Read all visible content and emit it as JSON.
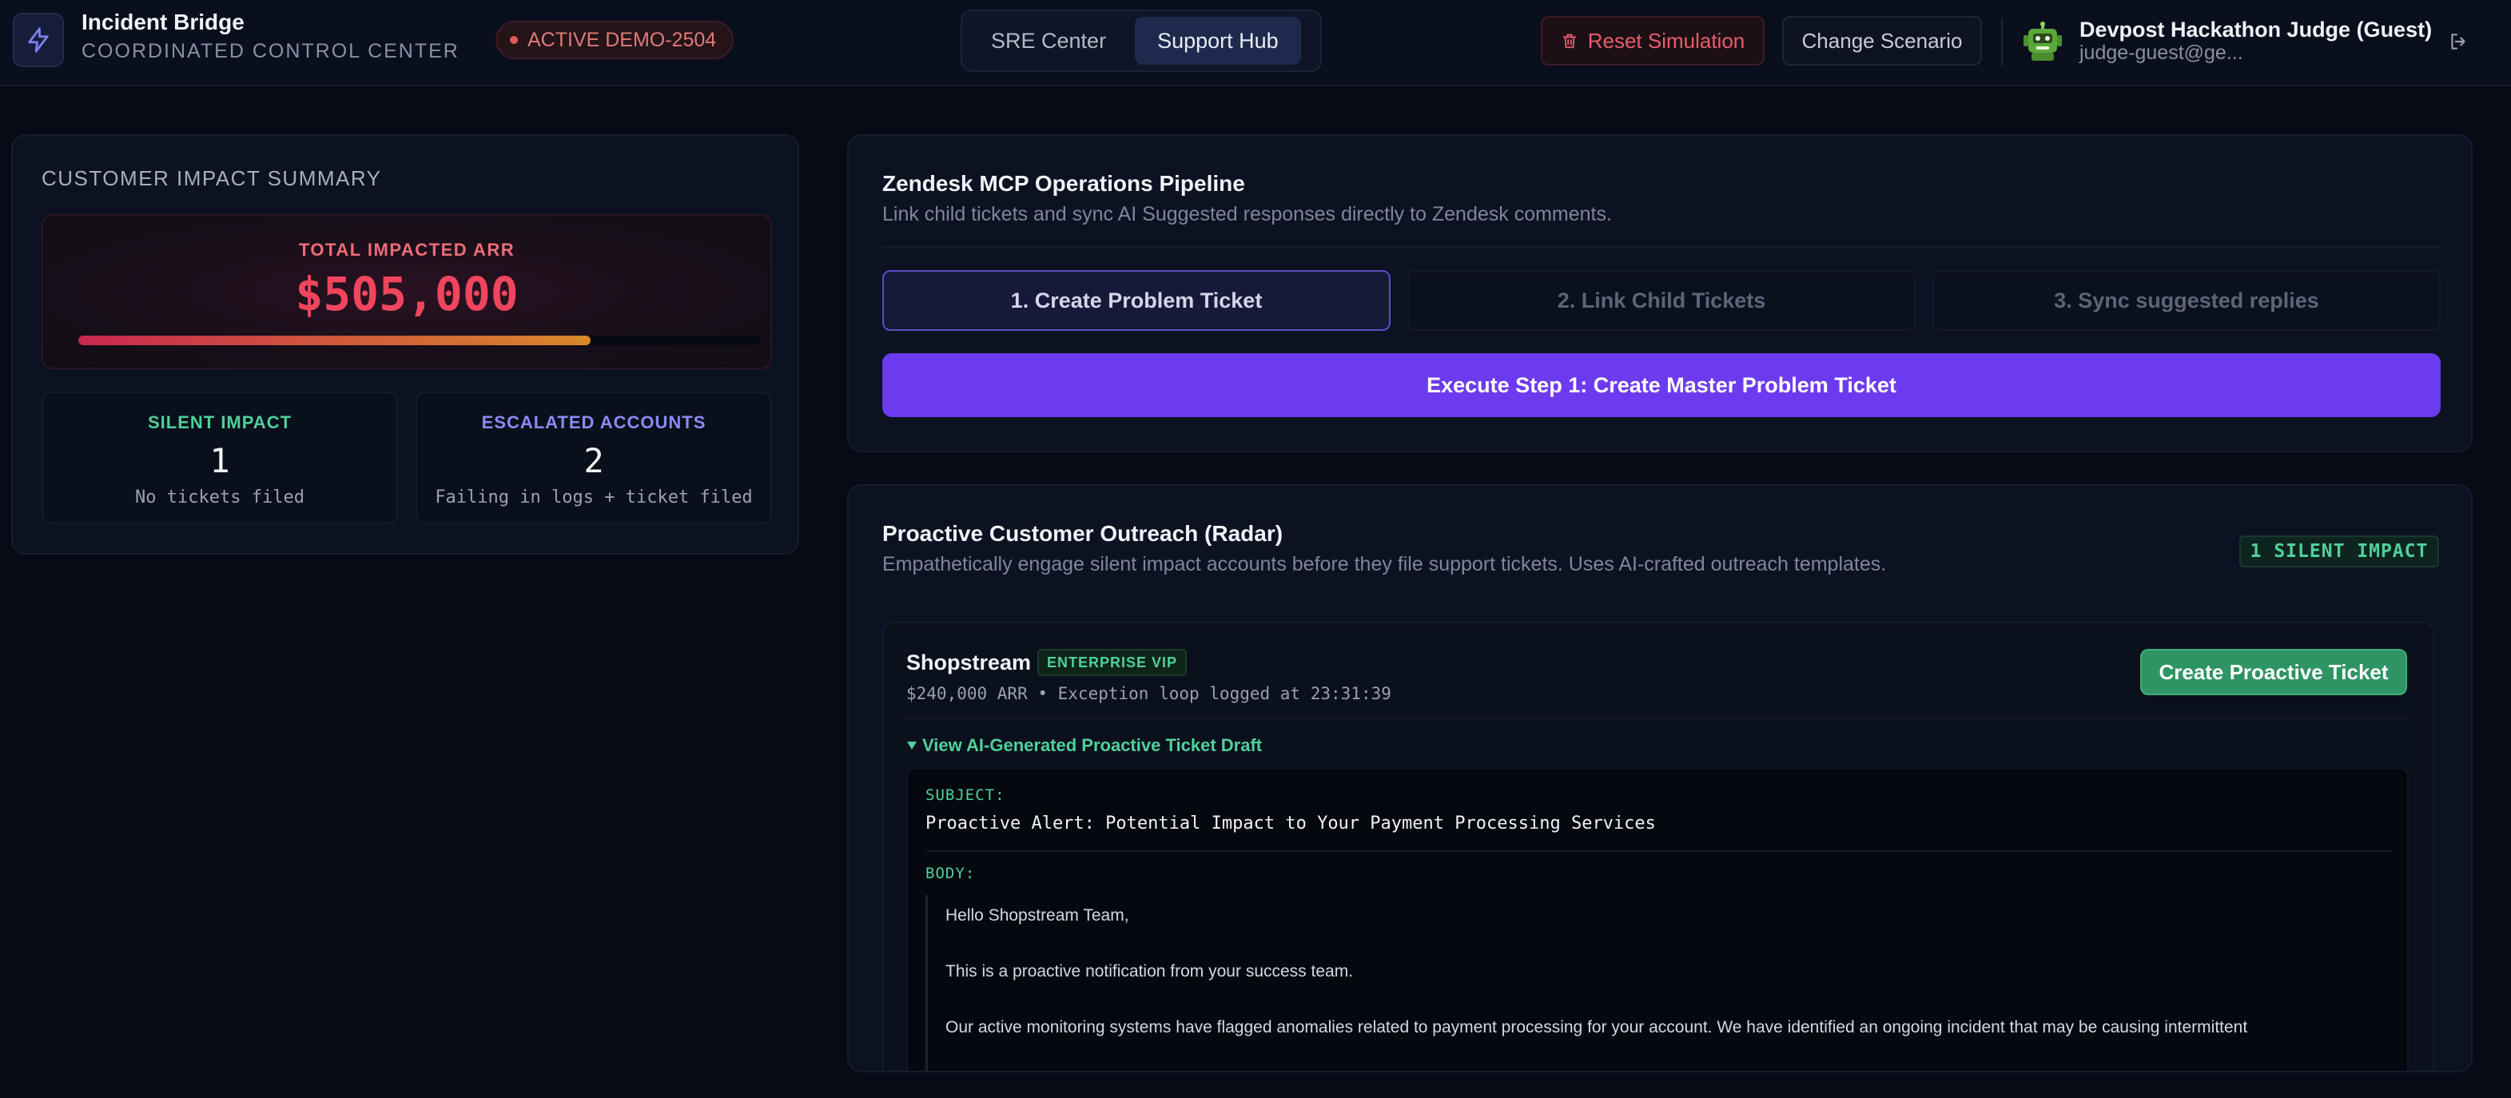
{
  "header": {
    "app_title": "Incident Bridge",
    "app_subtitle": "COORDINATED CONTROL CENTER",
    "active_badge": "ACTIVE DEMO-2504",
    "tabs": [
      {
        "label": "SRE Center",
        "active": false
      },
      {
        "label": "Support Hub",
        "active": true
      }
    ],
    "reset_label": "Reset Simulation",
    "change_label": "Change Scenario",
    "user_name": "Devpost Hackathon Judge (Guest)",
    "user_email": "judge-guest@ge..."
  },
  "summary": {
    "title": "CUSTOMER IMPACT SUMMARY",
    "total_label": "TOTAL IMPACTED ARR",
    "total_value": "$505,000",
    "progress_fraction": 0.75,
    "silent": {
      "label": "SILENT IMPACT",
      "value": "1",
      "desc": "No tickets filed"
    },
    "escalated": {
      "label": "ESCALATED ACCOUNTS",
      "value": "2",
      "desc": "Failing in logs + ticket filed"
    }
  },
  "pipeline": {
    "title": "Zendesk MCP Operations Pipeline",
    "desc": "Link child tickets and sync AI Suggested responses directly to Zendesk comments.",
    "steps": [
      {
        "label": "1. Create Problem Ticket",
        "active": true
      },
      {
        "label": "2. Link Child Tickets",
        "active": false
      },
      {
        "label": "3. Sync suggested replies",
        "active": false
      }
    ],
    "execute_label": "Execute Step 1: Create Master Problem Ticket"
  },
  "outreach": {
    "title": "Proactive Customer Outreach (Radar)",
    "desc": "Empathetically engage silent impact accounts before they file support tickets. Uses AI-crafted outreach templates.",
    "badge": "1 SILENT IMPACT",
    "account": {
      "name": "Shopstream",
      "tier": "ENTERPRISE VIP",
      "meta": "$240,000 ARR • Exception loop logged at 23:31:39",
      "cta": "Create Proactive Ticket",
      "draft_toggle": "View AI-Generated Proactive Ticket Draft",
      "subject_label": "SUBJECT:",
      "subject": "Proactive Alert: Potential Impact to Your Payment Processing Services",
      "body_label": "BODY:",
      "body_lines": [
        "Hello Shopstream Team,",
        "This is a proactive notification from your success team.",
        "Our active monitoring systems have flagged anomalies related to payment processing for your account. We have identified an ongoing incident that may be causing intermittent"
      ]
    }
  },
  "colors": {
    "accent_purple": "#6d3bef",
    "success_green": "#4fd19a",
    "danger_red": "#f0455e",
    "escalated_blue": "#8a8cf5"
  },
  "icons": {
    "logo": "lightning-icon",
    "reset": "trash-icon",
    "avatar": "robot-icon",
    "logout": "logout-icon",
    "toggle": "triangle-down-icon"
  }
}
